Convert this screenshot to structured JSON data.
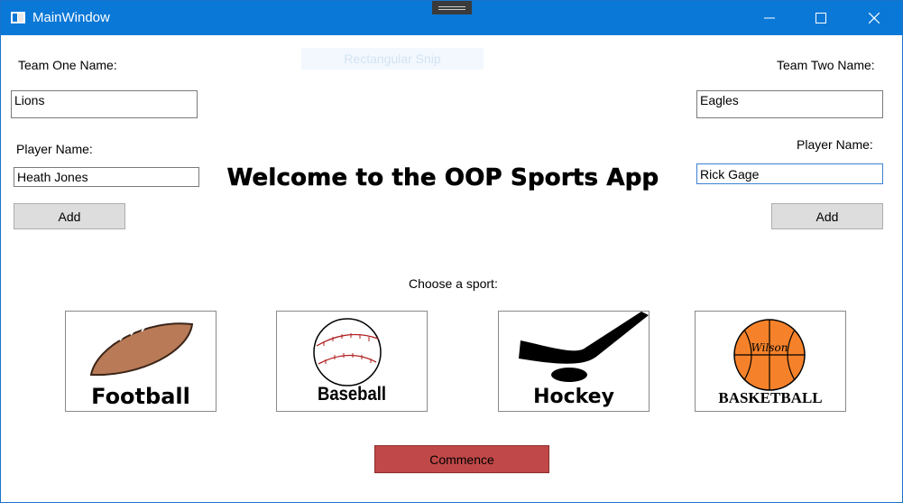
{
  "window": {
    "title": "MainWindow"
  },
  "ghost_text": "Rectangular Snip",
  "team_one": {
    "name_label": "Team One Name:",
    "name_value": "Lions",
    "player_label": "Player Name:",
    "player_value": "Heath Jones",
    "add_label": "Add"
  },
  "team_two": {
    "name_label": "Team Two Name:",
    "name_value": "Eagles",
    "player_label": "Player Name:",
    "player_value": "Rick Gage",
    "add_label": "Add"
  },
  "headline": "Welcome to the OOP Sports App",
  "choose_label": "Choose a sport:",
  "sports": [
    {
      "label": "Football",
      "icon": "football-icon"
    },
    {
      "label": "Baseball",
      "icon": "baseball-icon"
    },
    {
      "label": "Hockey",
      "icon": "hockey-stick-icon"
    },
    {
      "label": "BASKETBALL",
      "icon": "basketball-icon",
      "ball_text": "Wilson"
    }
  ],
  "commence_label": "Commence",
  "colors": {
    "titlebar": "#0a78d7",
    "commence": "#c04848",
    "football": "#b97a57",
    "basketball": "#f5822a"
  }
}
